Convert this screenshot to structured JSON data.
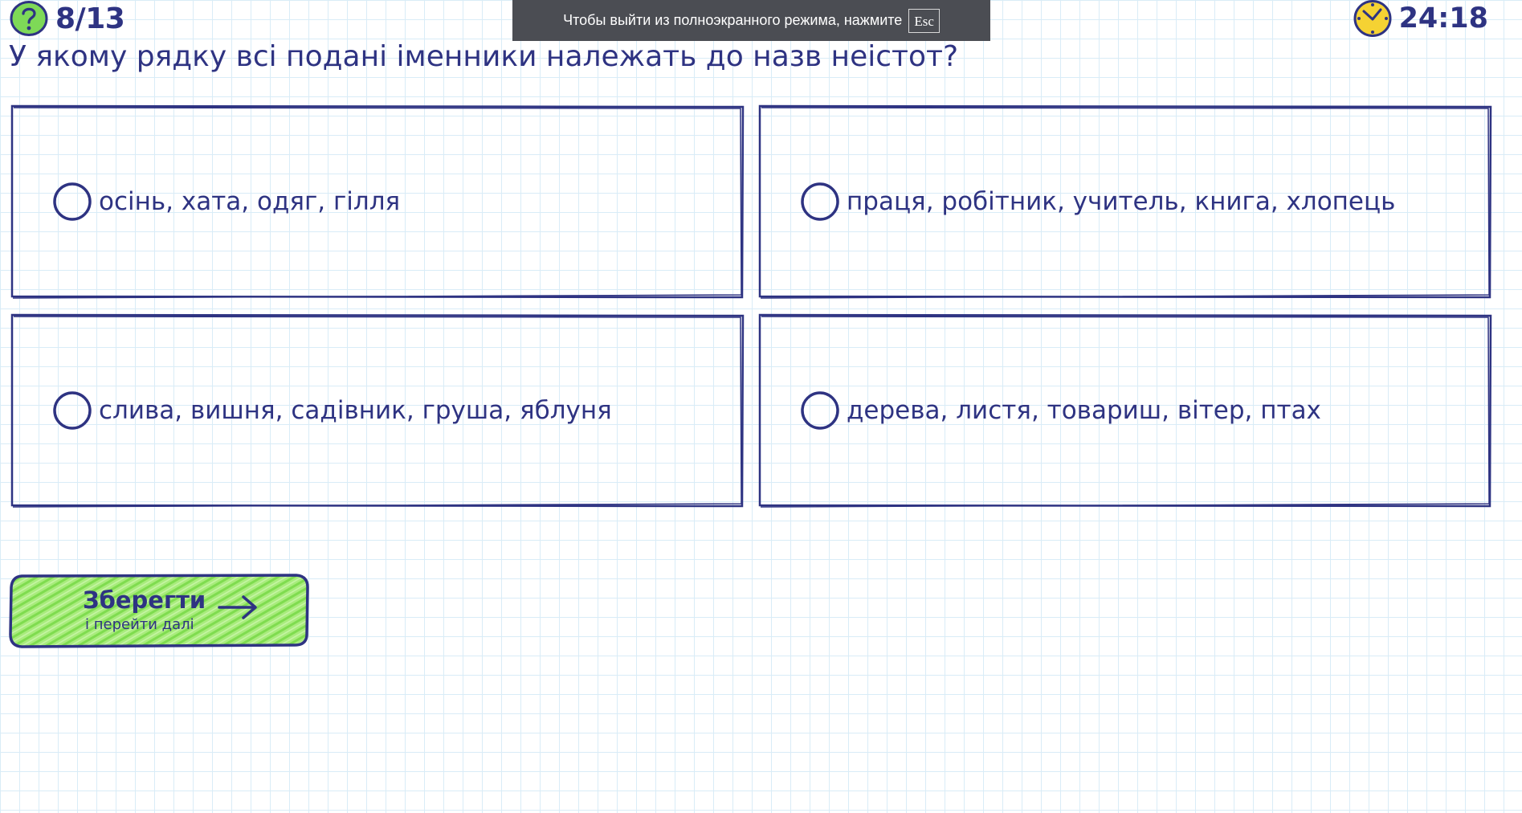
{
  "header": {
    "counter": "8/13",
    "timer": "24:18",
    "icons": {
      "help": "question-circle-icon",
      "timer": "clock-icon"
    }
  },
  "fullscreen_banner": {
    "message": "Чтобы выйти из полноэкранного режима, нажмите",
    "key": "Esc"
  },
  "question": "У якому рядку всі подані іменники належать до назв неістот?",
  "answers": [
    {
      "label": "осінь, хата, одяг, гілля",
      "selected": false
    },
    {
      "label": "праця, робітник, учитель, книга, хлопець",
      "selected": false
    },
    {
      "label": "слива, вишня, садівник, груша, яблуня",
      "selected": false
    },
    {
      "label": "дерева, листя, товариш, вітер, птах",
      "selected": false
    }
  ],
  "save_button": {
    "title": "Зберегти",
    "subtitle": "і перейти далі",
    "icon": "arrow-right-icon"
  },
  "colors": {
    "primary": "#2e3382",
    "accent_green": "#8fe05a",
    "clock_yellow": "#f5d233",
    "help_green": "#7ed957",
    "grid": "#d9ecf7",
    "banner_bg": "#4b4d53"
  }
}
